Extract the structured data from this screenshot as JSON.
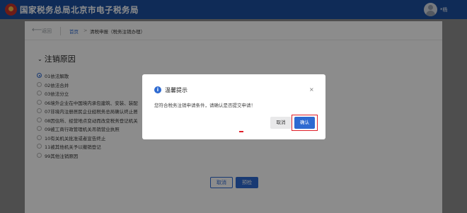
{
  "header": {
    "title": "国家税务总局北京市电子税务局",
    "user_name": "*杨"
  },
  "breadcrumb": {
    "back_label": "返回",
    "home": "首页",
    "separator": ">",
    "current": "清税申报（税务注销办理）"
  },
  "section": {
    "title": "注销原因"
  },
  "reasons": [
    {
      "label": "01依法解散",
      "selected": true
    },
    {
      "label": "02依法合并",
      "selected": false
    },
    {
      "label": "03依法分立",
      "selected": false
    },
    {
      "label": "06境外企业在中国境内承包建筑、安装、装配",
      "selected": false
    },
    {
      "label": "07非境内注册居民企业经税务总局确认终止居",
      "selected": false
    },
    {
      "label": "08因住所、经营地点变动而改变税务登记机关",
      "selected": false
    },
    {
      "label": "09被工商行政管理机关吊销营业执照",
      "selected": false
    },
    {
      "label": "10有关机关批准或者宣告终止",
      "selected": false
    },
    {
      "label": "11被其他机关予以撤销登记",
      "selected": false
    },
    {
      "label": "99其他注销原因",
      "selected": false
    }
  ],
  "page_buttons": {
    "cancel": "取消",
    "next": "预检"
  },
  "dialog": {
    "icon": "info-icon",
    "title": "温馨提示",
    "close": "×",
    "message": "您符合税务注销申请条件，请确认是否提交申请！",
    "cancel": "取消",
    "confirm": "确认"
  },
  "colors": {
    "header_bg": "#1d4f9e",
    "accent": "#2e6ad1",
    "highlight": "#e0202a"
  }
}
